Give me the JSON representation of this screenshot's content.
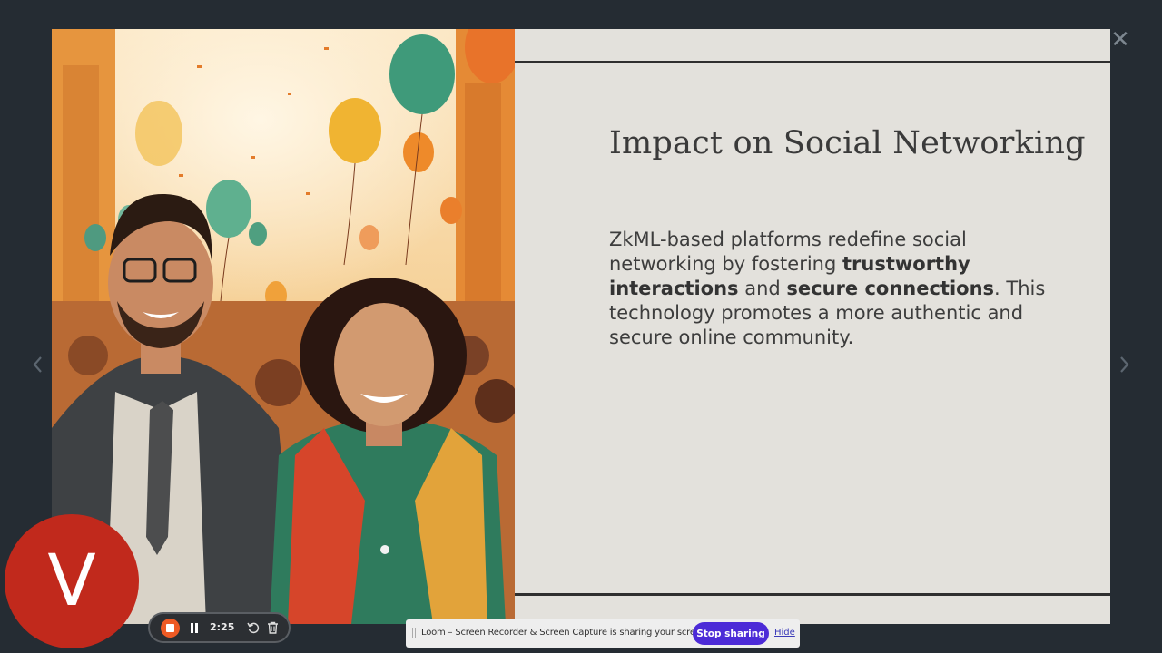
{
  "slide": {
    "title": "Impact on Social Networking",
    "body": {
      "part1": "ZkML-based platforms redefine social networking by fostering ",
      "bold1": "trustworthy interactions",
      "part2": " and ",
      "bold2": "secure connections",
      "part3": ". This technology promotes a more authentic and secure online community."
    },
    "image_alt": "Illustration of a smiling crowd with balloons and confetti"
  },
  "viewer": {
    "close_icon": "close-icon",
    "prev_icon": "chevron-left-icon",
    "next_icon": "chevron-right-icon"
  },
  "avatar": {
    "letter": "V",
    "color": "#c1291c"
  },
  "recorder": {
    "time": "2:25",
    "stop_color": "#ee5a24"
  },
  "share_bar": {
    "message": "Loom – Screen Recorder & Screen Capture is sharing your screen.",
    "stop_label": "Stop sharing",
    "hide_label": "Hide",
    "stop_color": "#4c2bd7"
  },
  "colors": {
    "background": "#252c33",
    "slide_background": "#e3e1dc"
  }
}
